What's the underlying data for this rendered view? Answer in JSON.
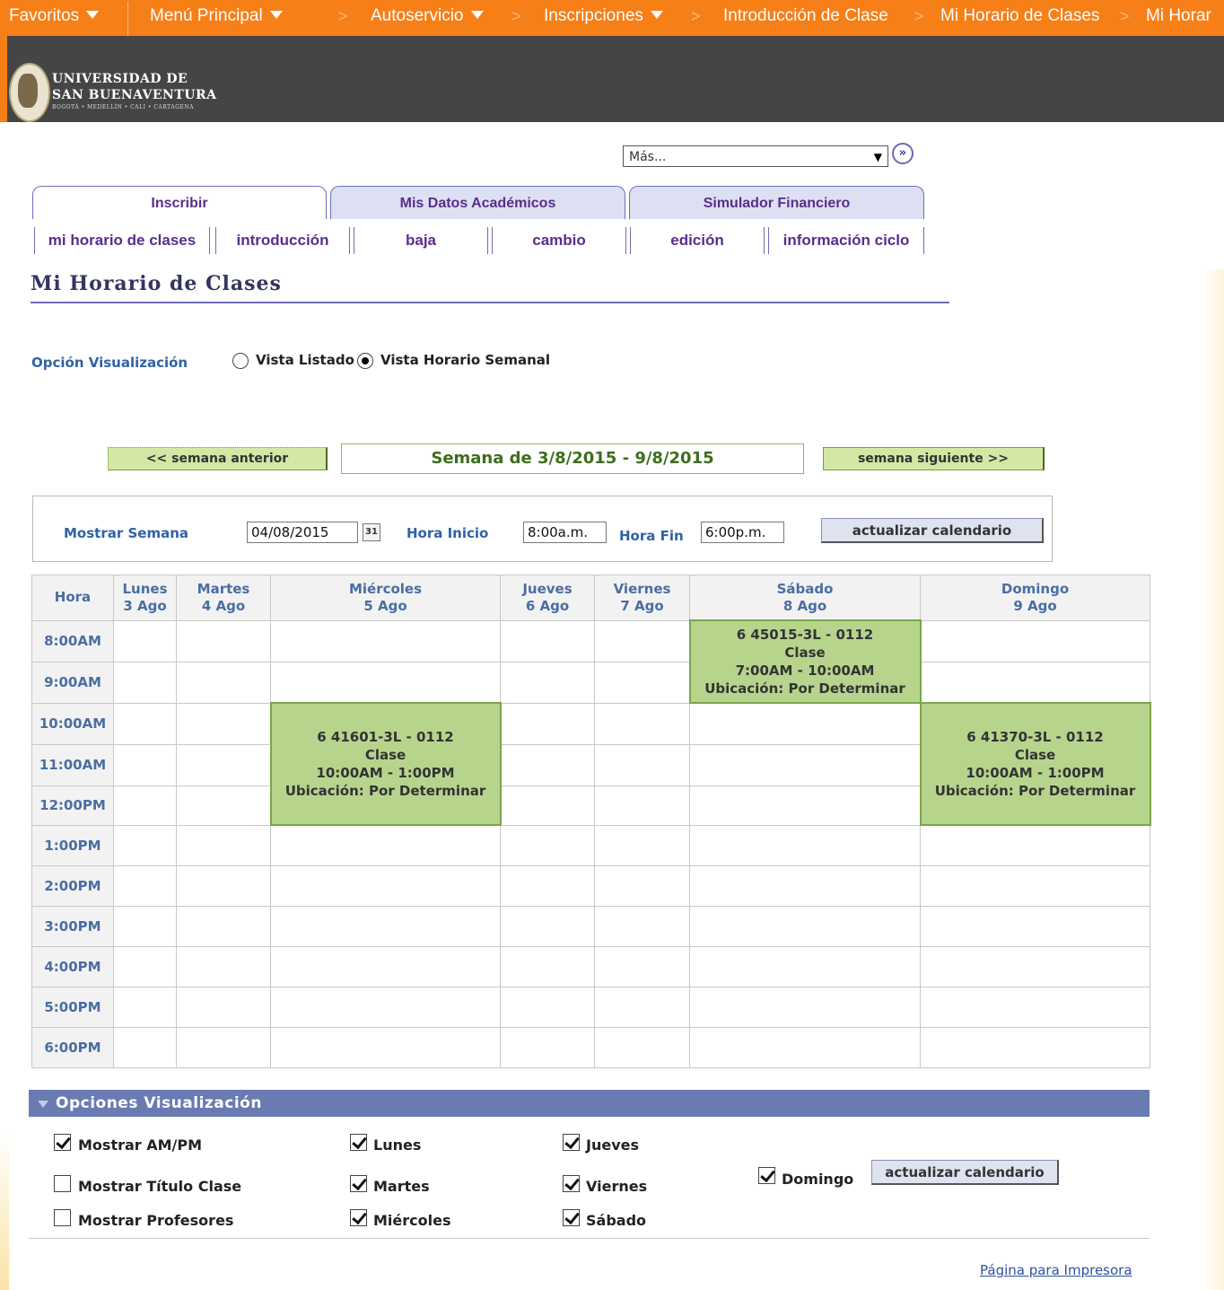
{
  "topnav": {
    "favorites": "Favoritos",
    "main_menu": "Menú Principal",
    "items": [
      "Autoservicio",
      "Inscripciones",
      "Introducción de Clase",
      "Mi Horario de Clases",
      "Mi Horar"
    ]
  },
  "logo": {
    "line1": "UNIVERSIDAD DE",
    "line2": "SAN BUENAVENTURA",
    "line3": "BOGOTÁ • MEDELLÍN • CALI • CARTAGENA"
  },
  "more_select": {
    "value": "Más...",
    "go": "»"
  },
  "tabs": [
    "Inscribir",
    "Mis Datos Académicos",
    "Simulador Financiero"
  ],
  "subtabs": [
    "mi horario de clases",
    "introducción",
    "baja",
    "cambio",
    "edición",
    "información ciclo"
  ],
  "page_title": "Mi Horario de Clases",
  "view_option": {
    "label": "Opción Visualización",
    "list": "Vista Listado",
    "weekly": "Vista Horario Semanal",
    "selected": "weekly"
  },
  "week_nav": {
    "prev": "<< semana anterior",
    "label": "Semana de 3/8/2015 - 9/8/2015",
    "next": "semana siguiente >>"
  },
  "week_panel": {
    "show_week_label": "Mostrar Semana",
    "date": "04/08/2015",
    "calendar_icon": "31",
    "start_label": "Hora Inicio",
    "start": "8:00a.m.",
    "end_label": "Hora Fin",
    "end": "6:00p.m.",
    "refresh": "actualizar calendario"
  },
  "schedule": {
    "hour_header": "Hora",
    "days": [
      {
        "name": "Lunes",
        "date": "3 Ago"
      },
      {
        "name": "Martes",
        "date": "4 Ago"
      },
      {
        "name": "Miércoles",
        "date": "5 Ago"
      },
      {
        "name": "Jueves",
        "date": "6 Ago"
      },
      {
        "name": "Viernes",
        "date": "7 Ago"
      },
      {
        "name": "Sábado",
        "date": "8 Ago"
      },
      {
        "name": "Domingo",
        "date": "9 Ago"
      }
    ],
    "hours": [
      "8:00AM",
      "9:00AM",
      "10:00AM",
      "11:00AM",
      "12:00PM",
      "1:00PM",
      "2:00PM",
      "3:00PM",
      "4:00PM",
      "5:00PM",
      "6:00PM"
    ],
    "classes": [
      {
        "code": "6 45015-3L - 0112",
        "type": "Clase",
        "time": "7:00AM - 10:00AM",
        "location": "Ubicación: Por Determinar"
      },
      {
        "code": "6 41601-3L - 0112",
        "type": "Clase",
        "time": "10:00AM - 1:00PM",
        "location": "Ubicación: Por Determinar"
      },
      {
        "code": "6 41370-3L - 0112",
        "type": "Clase",
        "time": "10:00AM - 1:00PM",
        "location": "Ubicación: Por Determinar"
      }
    ]
  },
  "display_options": {
    "title": "Opciones Visualización",
    "show_ampm": "Mostrar AM/PM",
    "show_class_title": "Mostrar Título Clase",
    "show_instructors": "Mostrar Profesores",
    "monday": "Lunes",
    "tuesday": "Martes",
    "wednesday": "Miércoles",
    "thursday": "Jueves",
    "friday": "Viernes",
    "saturday": "Sábado",
    "sunday": "Domingo",
    "refresh": "actualizar calendario"
  },
  "print_link": "Página para Impresora",
  "colors": {
    "nav_orange": "#f77f18",
    "banner_gray": "#454545",
    "class_green": "#b7d48d",
    "options_bar": "#6a7bb3"
  }
}
